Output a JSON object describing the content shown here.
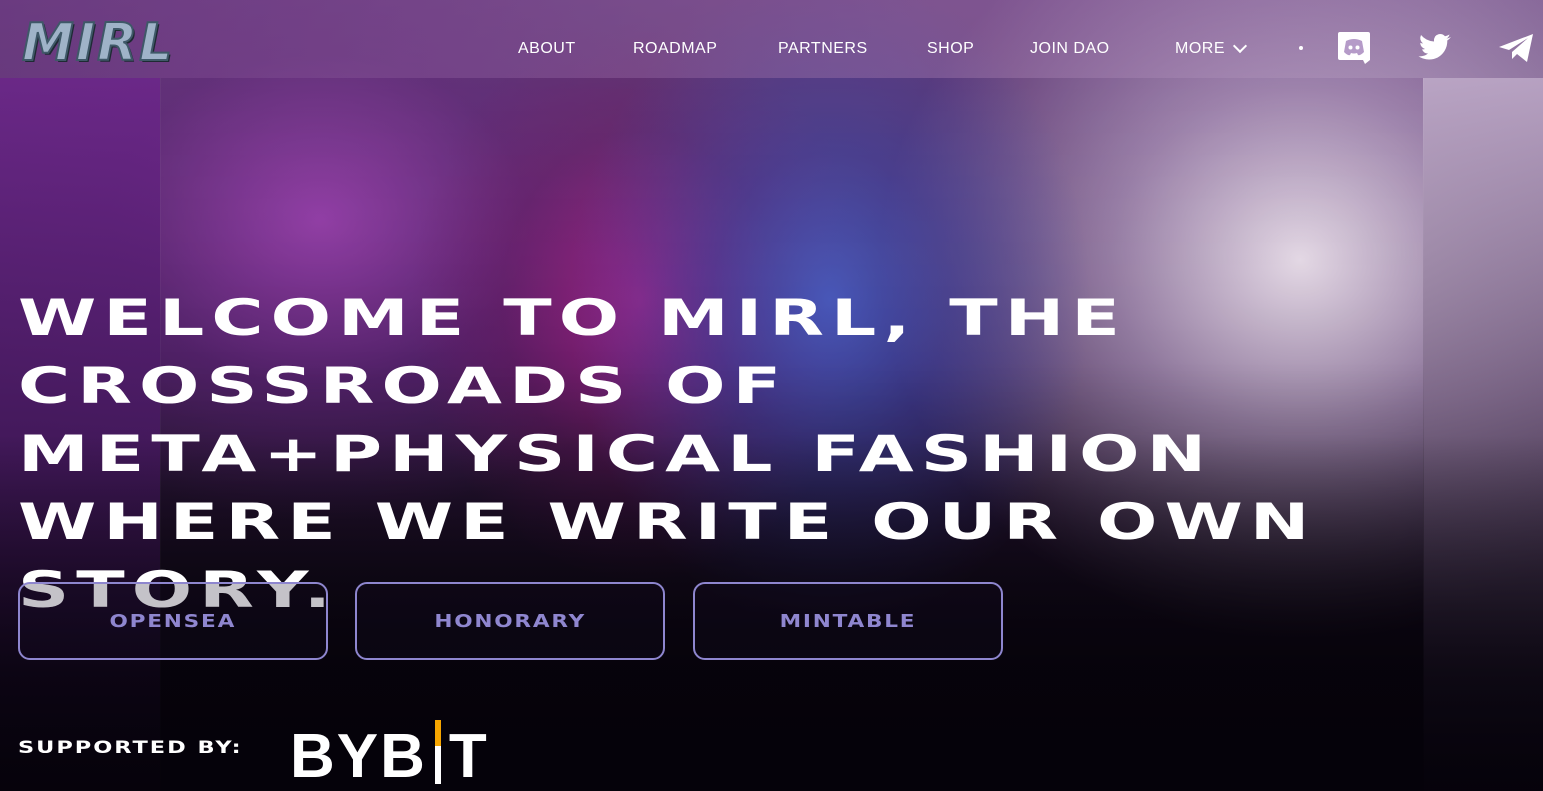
{
  "brand": {
    "logo_text": "MIRL"
  },
  "nav": {
    "items": [
      {
        "label": "ABOUT"
      },
      {
        "label": "ROADMAP"
      },
      {
        "label": "PARTNERS"
      },
      {
        "label": "SHOP"
      },
      {
        "label": "JOIN DAO"
      },
      {
        "label": "MORE"
      }
    ]
  },
  "social": {
    "icons": [
      "discord-icon",
      "twitter-icon",
      "telegram-icon"
    ]
  },
  "hero": {
    "headline": "WELCOME TO MIRL, THE CROSSROADS OF META+PHYSICAL FASHION WHERE WE WRITE OUR OWN STORY."
  },
  "buttons": {
    "opensea": "OPENSEA",
    "honorary": "HONORARY",
    "mintable": "MINTABLE"
  },
  "supporters": {
    "label": "SUPPORTED BY:",
    "sponsor_left": "BYB",
    "sponsor_right": "T"
  },
  "colors": {
    "cta_border": "#8e86cf",
    "cta_text": "#8f86cf",
    "bybit_accent": "#f7a600"
  }
}
